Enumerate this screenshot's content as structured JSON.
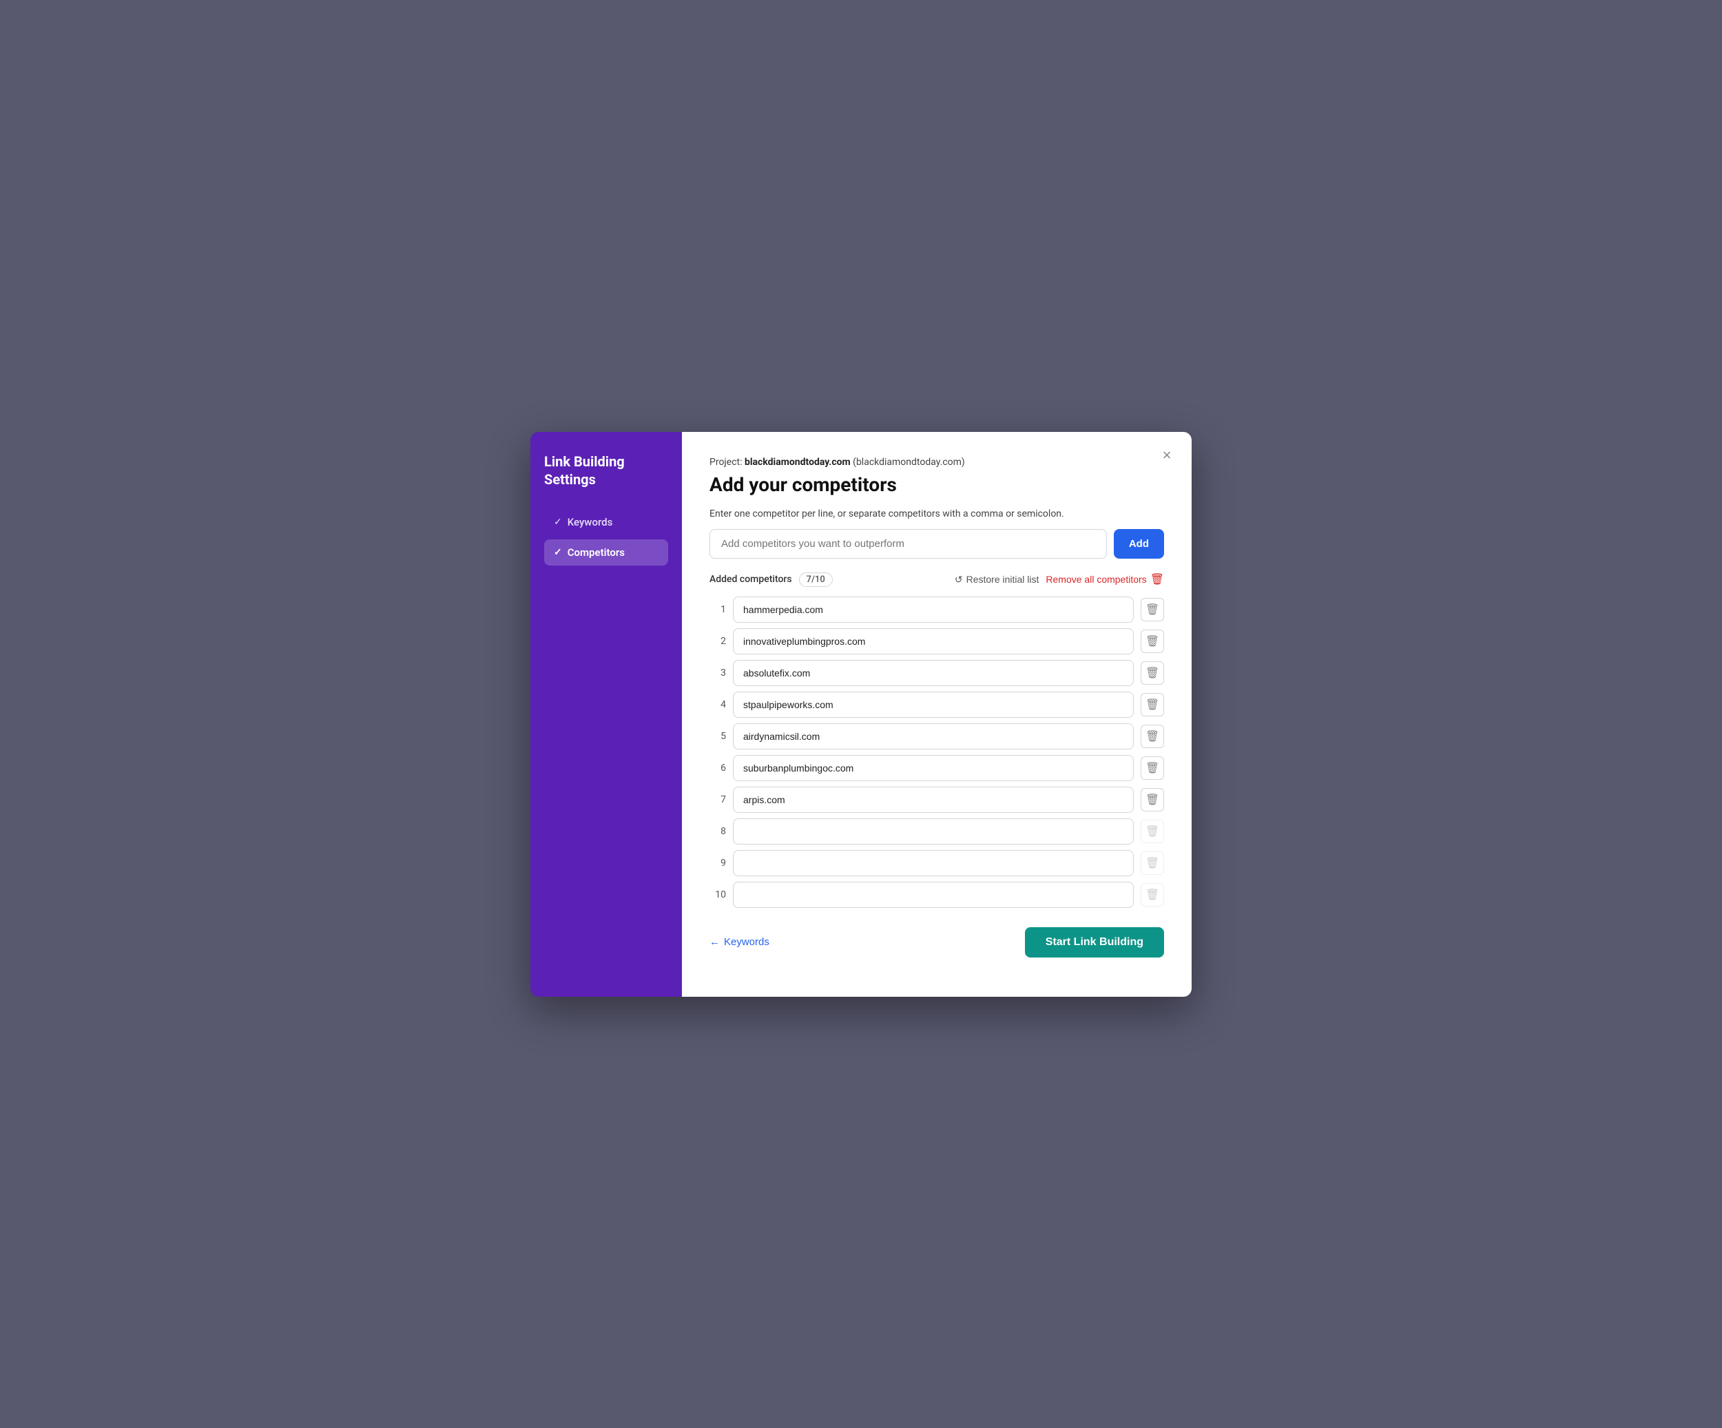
{
  "sidebar": {
    "title": "Link Building Settings",
    "items": [
      {
        "id": "keywords",
        "label": "Keywords",
        "active": false,
        "checked": true
      },
      {
        "id": "competitors",
        "label": "Competitors",
        "active": true,
        "checked": true
      }
    ]
  },
  "modal": {
    "close_label": "×",
    "project_prefix": "Project: ",
    "project_name": "blackdiamondtoday.com",
    "project_domain": "(blackdiamondtoday.com)",
    "title": "Add your competitors",
    "instruction": "Enter one competitor per line, or separate competitors with a comma or semicolon.",
    "input_placeholder": "Add competitors you want to outperform",
    "add_button": "Add",
    "added_competitors_label": "Added competitors",
    "count_badge": "7/10",
    "restore_label": "Restore initial list",
    "remove_all_label": "Remove all competitors",
    "competitors": [
      {
        "number": 1,
        "value": "hammerpedia.com",
        "empty": false
      },
      {
        "number": 2,
        "value": "innovativeplumbingpros.com",
        "empty": false
      },
      {
        "number": 3,
        "value": "absolutefix.com",
        "empty": false
      },
      {
        "number": 4,
        "value": "stpaulpipeworks.com",
        "empty": false
      },
      {
        "number": 5,
        "value": "airdynamicsil.com",
        "empty": false
      },
      {
        "number": 6,
        "value": "suburbanplumbingoc.com",
        "empty": false
      },
      {
        "number": 7,
        "value": "arpis.com",
        "empty": false
      },
      {
        "number": 8,
        "value": "",
        "empty": true
      },
      {
        "number": 9,
        "value": "",
        "empty": true
      },
      {
        "number": 10,
        "value": "",
        "empty": true
      }
    ],
    "back_button": "Keywords",
    "start_button": "Start Link Building"
  }
}
